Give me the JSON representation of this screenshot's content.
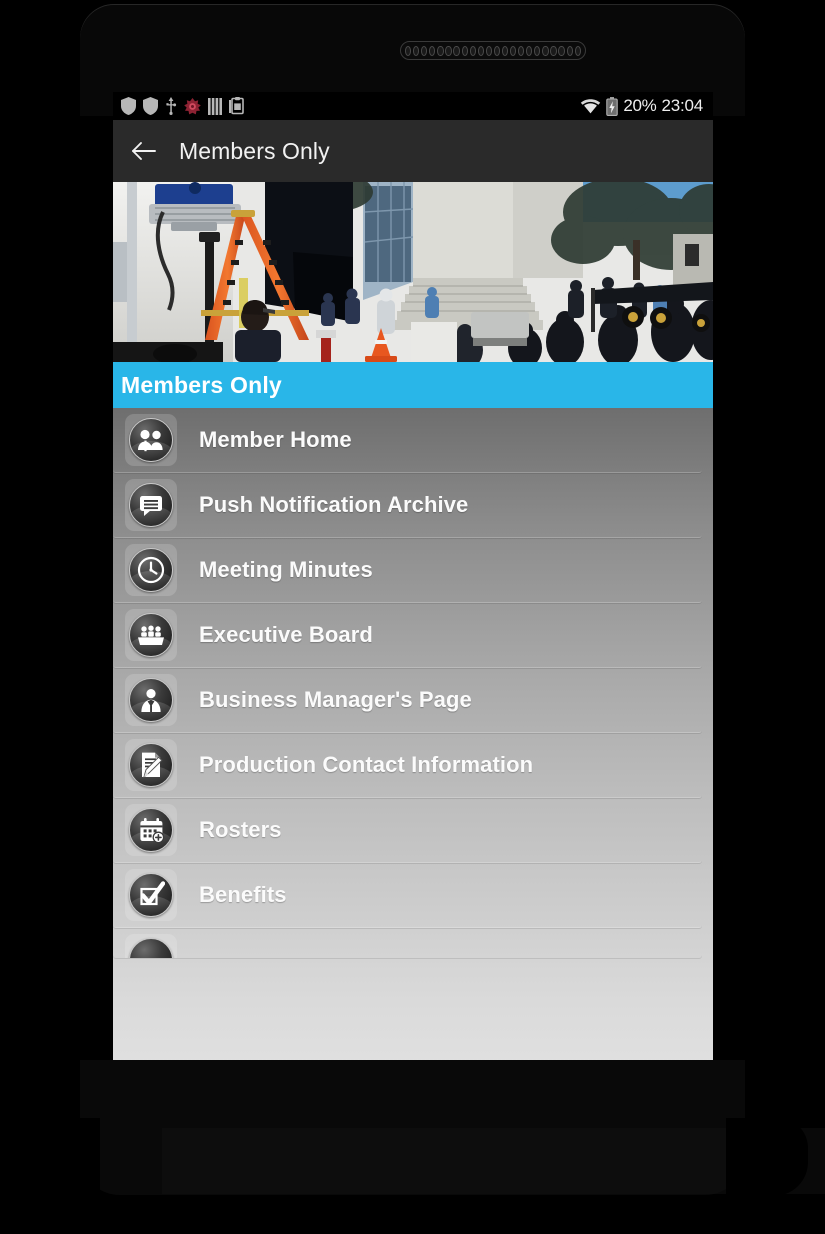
{
  "status_bar": {
    "left_icons": [
      "shield-icon",
      "shield-icon",
      "usb-icon",
      "flower-badge-icon",
      "bars-icon",
      "clipboard-icon"
    ],
    "right_icons": [
      "wifi-icon",
      "battery-charging-icon"
    ],
    "battery_percent": "20%",
    "clock": "23:04"
  },
  "action_bar": {
    "back_icon": "arrow-left-icon",
    "title": "Members Only"
  },
  "banner": {
    "alt": "film-set-production-photo"
  },
  "section_header": {
    "label": "Members Only",
    "color": "#29b6e8"
  },
  "menu": {
    "items": [
      {
        "label": "Member Home",
        "icon": "people-group-icon"
      },
      {
        "label": "Push Notification Archive",
        "icon": "speech-bubble-icon"
      },
      {
        "label": "Meeting Minutes",
        "icon": "clock-icon"
      },
      {
        "label": "Executive Board",
        "icon": "board-table-icon"
      },
      {
        "label": "Business Manager's Page",
        "icon": "businessman-icon"
      },
      {
        "label": "Production Contact Information",
        "icon": "document-pen-icon"
      },
      {
        "label": "Rosters",
        "icon": "calendar-icon"
      },
      {
        "label": "Benefits",
        "icon": "checkmark-icon"
      },
      {
        "label": "",
        "icon": "partial-icon"
      }
    ]
  },
  "nav_bar": {
    "buttons": [
      {
        "name": "volume-down-icon"
      },
      {
        "name": "recents-icon"
      },
      {
        "name": "home-icon"
      },
      {
        "name": "back-icon"
      },
      {
        "name": "volume-up-icon"
      }
    ]
  }
}
